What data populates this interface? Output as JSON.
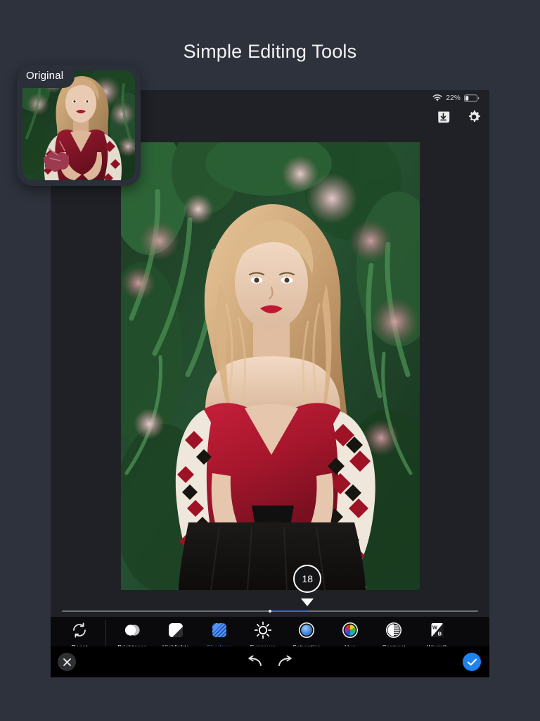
{
  "page": {
    "title": "Simple Editing Tools",
    "background_color": "#2e323c"
  },
  "original_card": {
    "badge_label": "Original",
    "name": "original-preview-thumbnail"
  },
  "device": {
    "app_background": "#1f2126",
    "statusbar": {
      "wifi_icon": "wifi-icon",
      "battery_percent": "22%",
      "battery_icon": "battery-icon"
    },
    "topbar": {
      "buttons": [
        {
          "name": "save-button",
          "icon": "download-icon"
        },
        {
          "name": "settings-button",
          "icon": "gear-icon"
        }
      ]
    },
    "slider": {
      "value": "18",
      "value_number": 18,
      "min": -100,
      "max": 100,
      "fill_color": "#2f6fd0",
      "track_color": "#6d7076",
      "handle_icon": "caret-down-handle"
    },
    "toolstrip": {
      "reset": {
        "label": "Reset",
        "icon": "reset-icon"
      },
      "tools": [
        {
          "label": "Brightness",
          "icon": "brightness-icon",
          "active": false
        },
        {
          "label": "Highlights",
          "icon": "highlights-icon",
          "active": false
        },
        {
          "label": "Shadows",
          "icon": "shadows-icon",
          "active": true
        },
        {
          "label": "Exposure",
          "icon": "exposure-icon",
          "active": false
        },
        {
          "label": "Saturation",
          "icon": "saturation-icon",
          "active": false
        },
        {
          "label": "Hue",
          "icon": "hue-icon",
          "active": false
        },
        {
          "label": "Contrast",
          "icon": "contrast-icon",
          "active": false
        },
        {
          "label": "Warmth",
          "icon": "warmth-icon",
          "active": false
        }
      ],
      "active_color": "#3d82ec",
      "warmth_glyph_top": "W",
      "warmth_glyph_bottom": "B"
    },
    "bottombar": {
      "close": {
        "name": "close-button",
        "icon": "close-x-icon"
      },
      "undo": {
        "name": "undo-button",
        "icon": "undo-arrow-icon"
      },
      "redo": {
        "name": "redo-button",
        "icon": "redo-arrow-icon"
      },
      "confirm": {
        "name": "confirm-button",
        "icon": "checkmark-icon",
        "color": "#1f82f0"
      }
    }
  }
}
